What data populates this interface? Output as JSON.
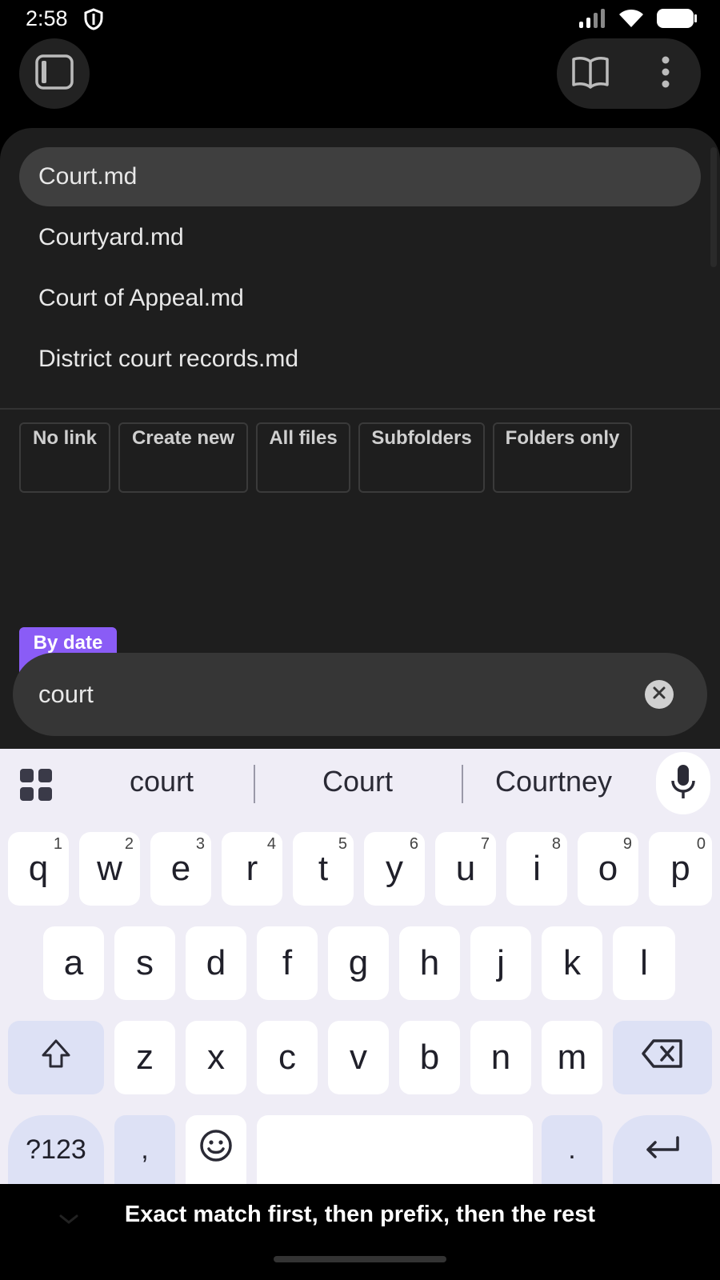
{
  "status_bar": {
    "time": "2:58"
  },
  "suggestions": [
    {
      "label": "Court.md",
      "selected": true
    },
    {
      "label": "Courtyard.md",
      "selected": false
    },
    {
      "label": "Court of Appeal.md",
      "selected": false
    },
    {
      "label": "District court records.md",
      "selected": false
    }
  ],
  "chips": [
    {
      "label": "No link",
      "active": false
    },
    {
      "label": "Create new",
      "active": false
    },
    {
      "label": "All files",
      "active": false
    },
    {
      "label": "Subfolders",
      "active": false
    },
    {
      "label": "Folders only",
      "active": false
    },
    {
      "label": "By date",
      "active": true
    }
  ],
  "search": {
    "value": "court"
  },
  "keyboard": {
    "word_suggestions": [
      "court",
      "Court",
      "Courtney"
    ],
    "row1": [
      "q",
      "w",
      "e",
      "r",
      "t",
      "y",
      "u",
      "i",
      "o",
      "p"
    ],
    "row1_hints": [
      "1",
      "2",
      "3",
      "4",
      "5",
      "6",
      "7",
      "8",
      "9",
      "0"
    ],
    "row2": [
      "a",
      "s",
      "d",
      "f",
      "g",
      "h",
      "j",
      "k",
      "l"
    ],
    "row3": [
      "z",
      "x",
      "c",
      "v",
      "b",
      "n",
      "m"
    ],
    "symbols_label": "?123",
    "comma_label": ",",
    "period_label": "."
  },
  "caption": "Exact match first, then prefix, then the rest",
  "colors": {
    "accent": "#8a5cf6",
    "panel": "#1e1e1e",
    "keyboard": "#efedf6"
  }
}
